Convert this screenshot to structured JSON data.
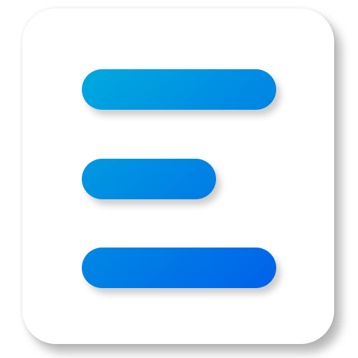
{
  "icon": {
    "name": "text-lines-icon",
    "tile_color": "#ffffff",
    "gradient": {
      "start": "#00aade",
      "end": "#0061ea"
    },
    "bars": [
      {
        "name": "top-bar"
      },
      {
        "name": "middle-bar"
      },
      {
        "name": "bottom-bar"
      }
    ]
  }
}
